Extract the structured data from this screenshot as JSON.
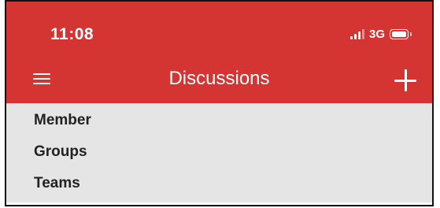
{
  "status_bar": {
    "time": "11:08",
    "network": "3G",
    "signal_icon": "cellular-signal-icon",
    "battery_icon": "battery-icon"
  },
  "header": {
    "title": "Discussions",
    "menu_icon": "hamburger-menu-icon",
    "add_icon": "plus-icon"
  },
  "list": {
    "items": [
      {
        "label": "Member"
      },
      {
        "label": "Groups"
      },
      {
        "label": "Teams"
      }
    ]
  },
  "colors": {
    "header_background": "#d43432",
    "list_background": "#e5e5e5",
    "text_light": "#ffffff",
    "text_dark": "#222222"
  }
}
